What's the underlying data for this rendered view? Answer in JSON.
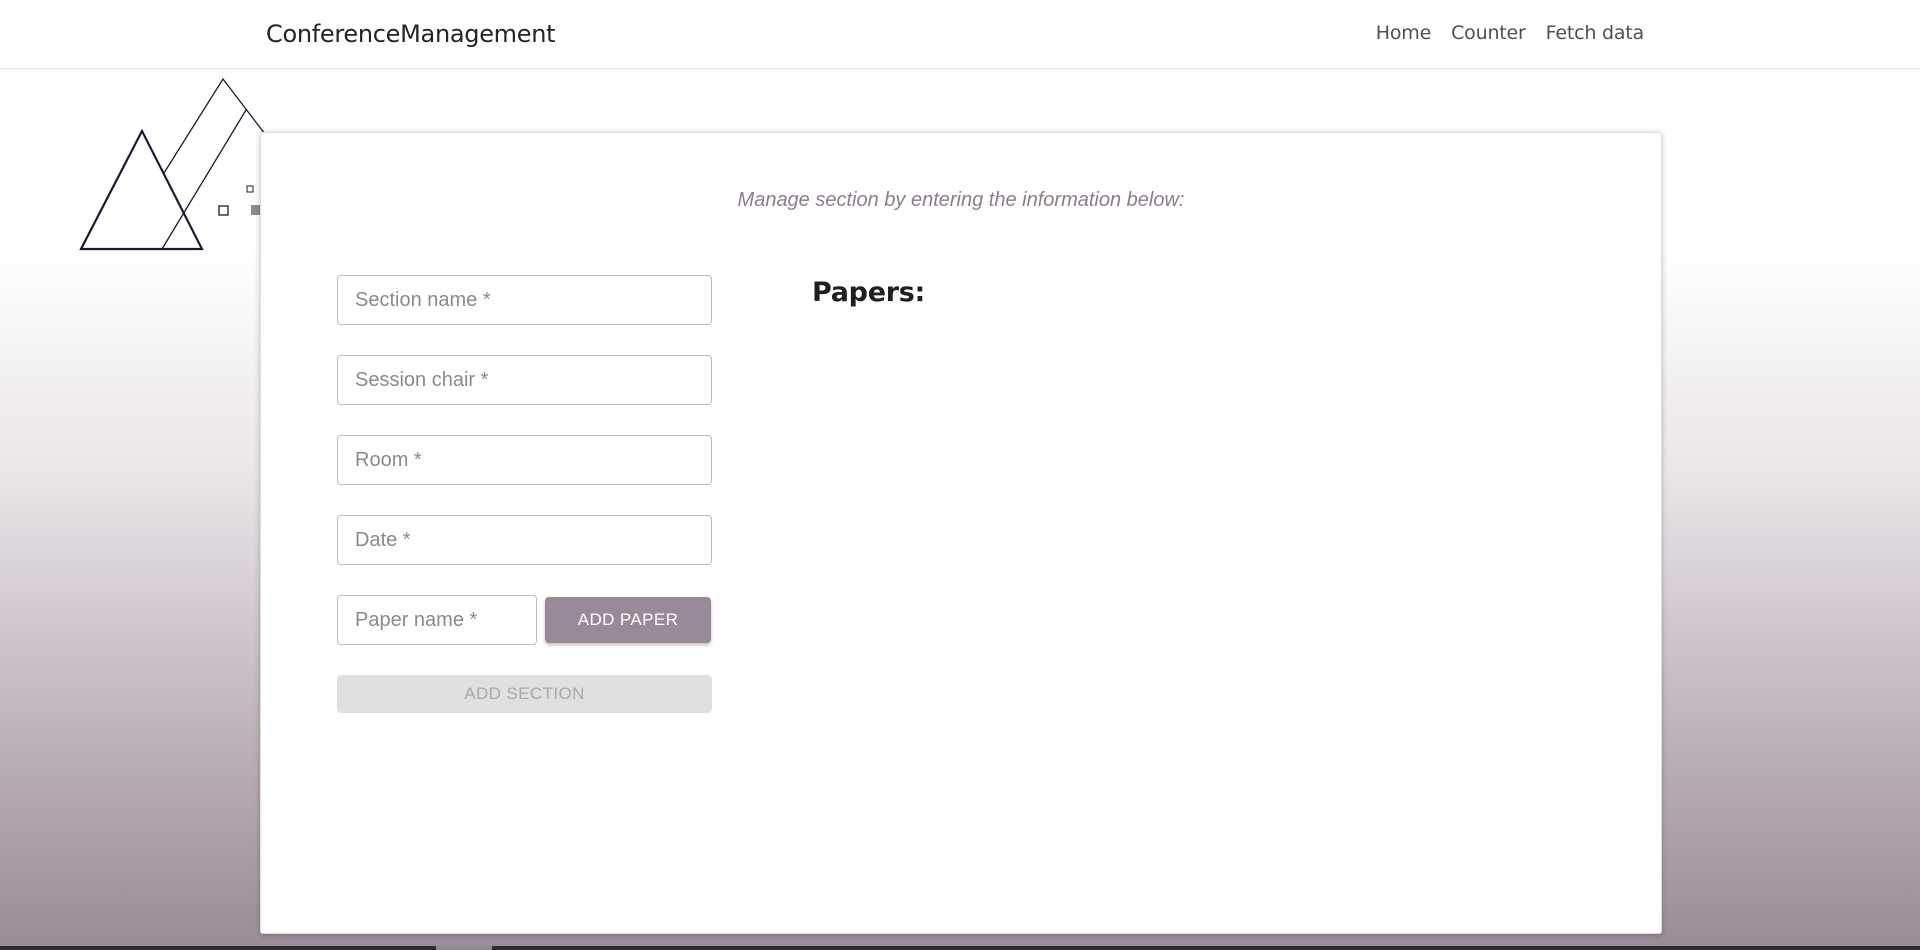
{
  "navbar": {
    "brand": "ConferenceManagement",
    "links": [
      "Home",
      "Counter",
      "Fetch data"
    ]
  },
  "form": {
    "subtitle": "Manage section by entering the information below:",
    "section_name_placeholder": "Section name *",
    "session_chair_placeholder": "Session chair *",
    "room_placeholder": "Room *",
    "date_placeholder": "Date *",
    "paper_name_placeholder": "Paper name *",
    "add_paper_label": "ADD PAPER",
    "add_section_label": "ADD SECTION"
  },
  "papers": {
    "heading": "Papers:",
    "items": []
  },
  "colors": {
    "accent": "#9a8a98",
    "subtitle": "#8c7d8a",
    "disabled_bg": "#e0e0e0",
    "disabled_text": "#a9a9a9",
    "logo_stroke": "#1c1a33"
  },
  "icons": {
    "logo": "triangles-logo-icon"
  }
}
